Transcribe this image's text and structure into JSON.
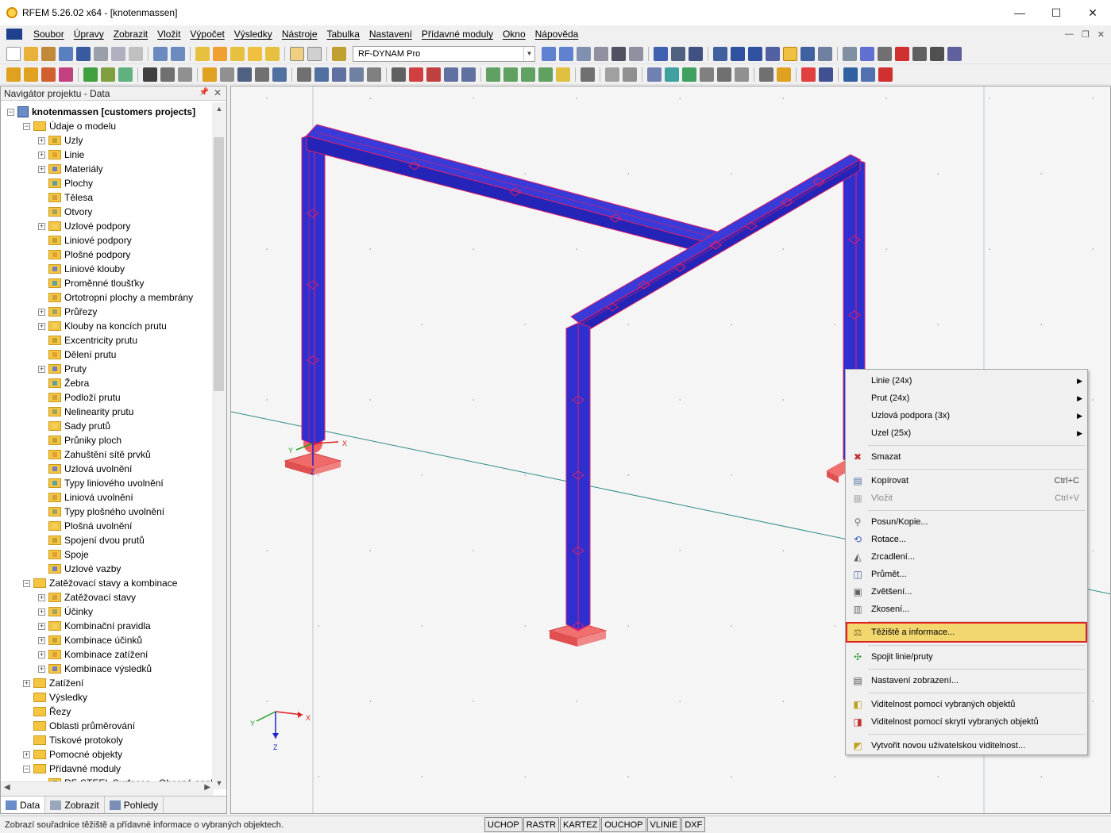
{
  "window": {
    "title": "RFEM 5.26.02 x64 - [knotenmassen]",
    "minimize": "—",
    "maximize": "☐",
    "close": "✕"
  },
  "menu": [
    "Soubor",
    "Úpravy",
    "Zobrazit",
    "Vložit",
    "Výpočet",
    "Výsledky",
    "Nástroje",
    "Tabulka",
    "Nastavení",
    "Přídavné moduly",
    "Okno",
    "Nápověda"
  ],
  "mdi": {
    "minimize": "—",
    "restore": "❐",
    "close": "✕"
  },
  "toolbar": {
    "module_select": "RF-DYNAM Pro"
  },
  "navigator": {
    "title": "Navigátor projektu - Data",
    "root": "knotenmassen [customers projects]",
    "items": [
      {
        "label": "Údaje o modelu",
        "level": 1,
        "exp": "-"
      },
      {
        "label": "Uzly",
        "level": 2,
        "exp": "+"
      },
      {
        "label": "Linie",
        "level": 2,
        "exp": "+"
      },
      {
        "label": "Materiály",
        "level": 2,
        "exp": "+"
      },
      {
        "label": "Plochy",
        "level": 2,
        "exp": ""
      },
      {
        "label": "Tělesa",
        "level": 2,
        "exp": ""
      },
      {
        "label": "Otvory",
        "level": 2,
        "exp": ""
      },
      {
        "label": "Uzlové podpory",
        "level": 2,
        "exp": "+"
      },
      {
        "label": "Liniové podpory",
        "level": 2,
        "exp": ""
      },
      {
        "label": "Plošné podpory",
        "level": 2,
        "exp": ""
      },
      {
        "label": "Liniové klouby",
        "level": 2,
        "exp": ""
      },
      {
        "label": "Proměnné tloušťky",
        "level": 2,
        "exp": ""
      },
      {
        "label": "Ortotropní plochy a membrány",
        "level": 2,
        "exp": ""
      },
      {
        "label": "Průřezy",
        "level": 2,
        "exp": "+"
      },
      {
        "label": "Klouby na koncích prutu",
        "level": 2,
        "exp": "+"
      },
      {
        "label": "Excentricity prutu",
        "level": 2,
        "exp": ""
      },
      {
        "label": "Dělení prutu",
        "level": 2,
        "exp": ""
      },
      {
        "label": "Pruty",
        "level": 2,
        "exp": "+"
      },
      {
        "label": "Žebra",
        "level": 2,
        "exp": ""
      },
      {
        "label": "Podloží prutu",
        "level": 2,
        "exp": ""
      },
      {
        "label": "Nelinearity prutu",
        "level": 2,
        "exp": ""
      },
      {
        "label": "Sady prutů",
        "level": 2,
        "exp": ""
      },
      {
        "label": "Průniky ploch",
        "level": 2,
        "exp": ""
      },
      {
        "label": "Zahuštění sítě prvků",
        "level": 2,
        "exp": ""
      },
      {
        "label": "Uzlová uvolnění",
        "level": 2,
        "exp": ""
      },
      {
        "label": "Typy liniového uvolnění",
        "level": 2,
        "exp": ""
      },
      {
        "label": "Liniová uvolnění",
        "level": 2,
        "exp": ""
      },
      {
        "label": "Typy plošného uvolnění",
        "level": 2,
        "exp": ""
      },
      {
        "label": "Plošná uvolnění",
        "level": 2,
        "exp": ""
      },
      {
        "label": "Spojení dvou prutů",
        "level": 2,
        "exp": ""
      },
      {
        "label": "Spoje",
        "level": 2,
        "exp": ""
      },
      {
        "label": "Uzlové vazby",
        "level": 2,
        "exp": ""
      },
      {
        "label": "Zatěžovací stavy a kombinace",
        "level": 1,
        "exp": "-"
      },
      {
        "label": "Zatěžovací stavy",
        "level": 2,
        "exp": "+"
      },
      {
        "label": "Účinky",
        "level": 2,
        "exp": "+"
      },
      {
        "label": "Kombinační pravidla",
        "level": 2,
        "exp": "+"
      },
      {
        "label": "Kombinace účinků",
        "level": 2,
        "exp": "+"
      },
      {
        "label": "Kombinace zatížení",
        "level": 2,
        "exp": "+"
      },
      {
        "label": "Kombinace výsledků",
        "level": 2,
        "exp": "+"
      },
      {
        "label": "Zatížení",
        "level": 1,
        "exp": "+"
      },
      {
        "label": "Výsledky",
        "level": 1,
        "exp": ""
      },
      {
        "label": "Řezy",
        "level": 1,
        "exp": ""
      },
      {
        "label": "Oblasti průměrování",
        "level": 1,
        "exp": ""
      },
      {
        "label": "Tiskové protokoly",
        "level": 1,
        "exp": ""
      },
      {
        "label": "Pomocné objekty",
        "level": 1,
        "exp": "+"
      },
      {
        "label": "Přídavné moduly",
        "level": 1,
        "exp": "-"
      },
      {
        "label": "RF-STEEL Surfaces - Obecná analý",
        "level": 2,
        "exp": ""
      }
    ],
    "tabs": [
      "Data",
      "Zobrazit",
      "Pohledy"
    ]
  },
  "viewport": {
    "axis_x": "X",
    "axis_y": "Y",
    "axis_z": "Z"
  },
  "context_menu": [
    {
      "label": "Linie (24x)",
      "sub": "▶"
    },
    {
      "label": "Prut (24x)",
      "sub": "▶"
    },
    {
      "label": "Uzlová podpora (3x)",
      "sub": "▶"
    },
    {
      "label": "Uzel (25x)",
      "sub": "▶"
    },
    {
      "label": "Smazat",
      "icon": "✖"
    },
    {
      "label": "Kopírovat",
      "shortcut": "Ctrl+C"
    },
    {
      "label": "Vložit",
      "shortcut": "Ctrl+V"
    },
    {
      "label": "Posun/Kopie..."
    },
    {
      "label": "Rotace..."
    },
    {
      "label": "Zrcadlení..."
    },
    {
      "label": "Průmět..."
    },
    {
      "label": "Zvětšení..."
    },
    {
      "label": "Zkosení..."
    },
    {
      "label": "Těžiště a informace..."
    },
    {
      "label": "Spojit linie/pruty"
    },
    {
      "label": "Nastavení zobrazení..."
    },
    {
      "label": "Viditelnost pomocí vybraných objektů"
    },
    {
      "label": "Viditelnost pomocí skrytí vybraných objektů"
    },
    {
      "label": "Vytvořit novou uživatelskou viditelnost..."
    }
  ],
  "status": {
    "text": "Zobrazí souřadnice těžiště a přídavné informace o vybraných objektech.",
    "toggles": [
      "UCHOP",
      "RASTR",
      "KARTEZ",
      "OUCHOP",
      "VLINIE",
      "DXF"
    ]
  },
  "colors": {
    "member": "#2f2fd0",
    "member_edge": "#e0206a",
    "support": "#f06060",
    "highlight": "#f2d66e"
  }
}
